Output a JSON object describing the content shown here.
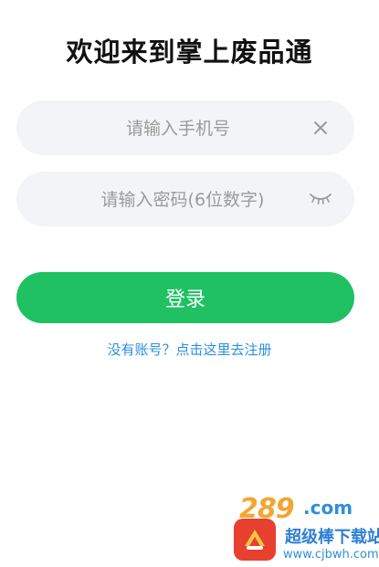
{
  "header": {
    "title": "欢迎来到掌上废品通"
  },
  "form": {
    "phone": {
      "placeholder": "请输入手机号",
      "value": "",
      "clear_icon": "close-icon"
    },
    "password": {
      "placeholder": "请输入密码(6位数字)",
      "value": "",
      "toggle_icon": "eye-closed-icon"
    },
    "login_label": "登录",
    "register_link": "没有账号？点击这里去注册"
  },
  "watermark": {
    "brand_number": "289",
    "brand_suffix": ".com",
    "site_name": "超级棒下载站",
    "url": "www.cjbwh.com"
  },
  "colors": {
    "accent_green": "#1fc163",
    "link_blue": "#2b8fe0",
    "field_bg": "#f3f4f7"
  }
}
